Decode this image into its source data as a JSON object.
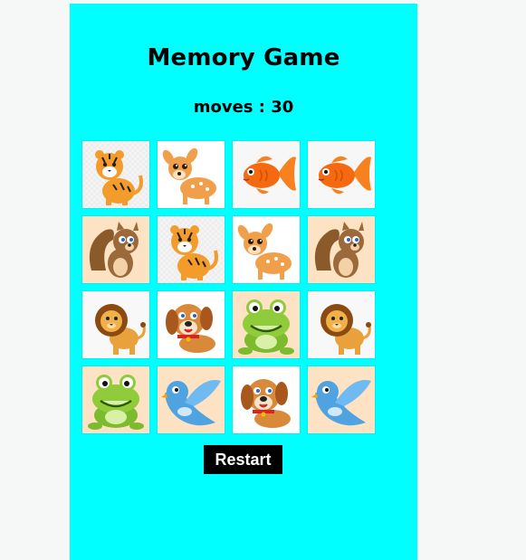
{
  "game": {
    "title": "Memory Game",
    "moves_text": "moves : 30",
    "restart_label": "Restart"
  },
  "cards": [
    {
      "animal": "tiger",
      "icon": "tiger-icon"
    },
    {
      "animal": "deer",
      "icon": "deer-icon"
    },
    {
      "animal": "goldfish",
      "icon": "goldfish-icon"
    },
    {
      "animal": "goldfish",
      "icon": "goldfish-icon"
    },
    {
      "animal": "squirrel",
      "icon": "squirrel-icon"
    },
    {
      "animal": "tiger",
      "icon": "tiger-icon"
    },
    {
      "animal": "deer",
      "icon": "deer-icon"
    },
    {
      "animal": "squirrel",
      "icon": "squirrel-icon"
    },
    {
      "animal": "lion",
      "icon": "lion-icon"
    },
    {
      "animal": "puppy",
      "icon": "puppy-icon"
    },
    {
      "animal": "frog",
      "icon": "frog-icon"
    },
    {
      "animal": "lion",
      "icon": "lion-icon"
    },
    {
      "animal": "frog",
      "icon": "frog-icon"
    },
    {
      "animal": "bird",
      "icon": "bird-icon"
    },
    {
      "animal": "puppy",
      "icon": "puppy-icon"
    },
    {
      "animal": "bird",
      "icon": "bird-icon"
    }
  ],
  "colors": {
    "panel_background": "#00ffff",
    "page_background": "#f6f7f7",
    "button_background": "#000000",
    "button_text": "#ffffff"
  }
}
